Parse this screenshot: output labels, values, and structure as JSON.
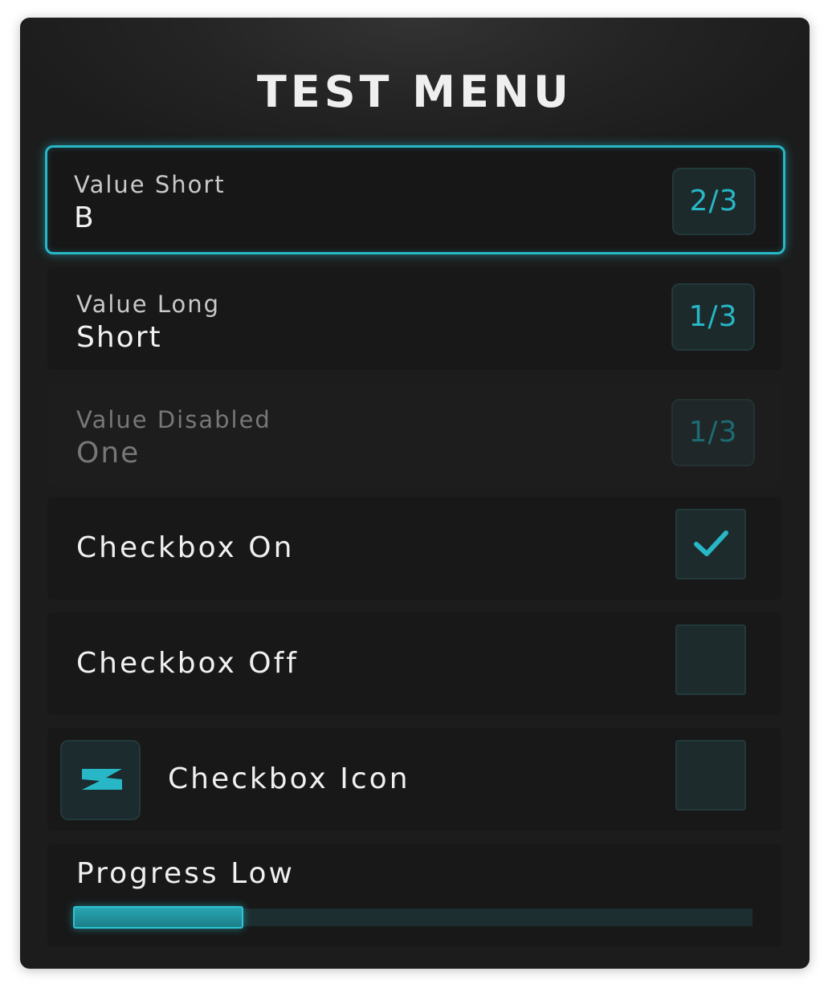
{
  "menu": {
    "title": "TEST MENU",
    "accent_color": "#27b7c6",
    "items": [
      {
        "label": "Value Short",
        "value": "B",
        "counter": "2/3",
        "state": "selected"
      },
      {
        "label": "Value Long",
        "value": "Short",
        "counter": "1/3",
        "state": "normal"
      },
      {
        "label": "Value Disabled",
        "value": "One",
        "counter": "1/3",
        "state": "disabled"
      },
      {
        "label": "Checkbox On",
        "checked": true,
        "icon": "checkmark-icon"
      },
      {
        "label": "Checkbox Off",
        "checked": false
      },
      {
        "label": "Checkbox Icon",
        "checked": false,
        "icon": "lightning-bolt-icon"
      },
      {
        "label": "Progress Low",
        "progress_percent": 25
      }
    ]
  }
}
